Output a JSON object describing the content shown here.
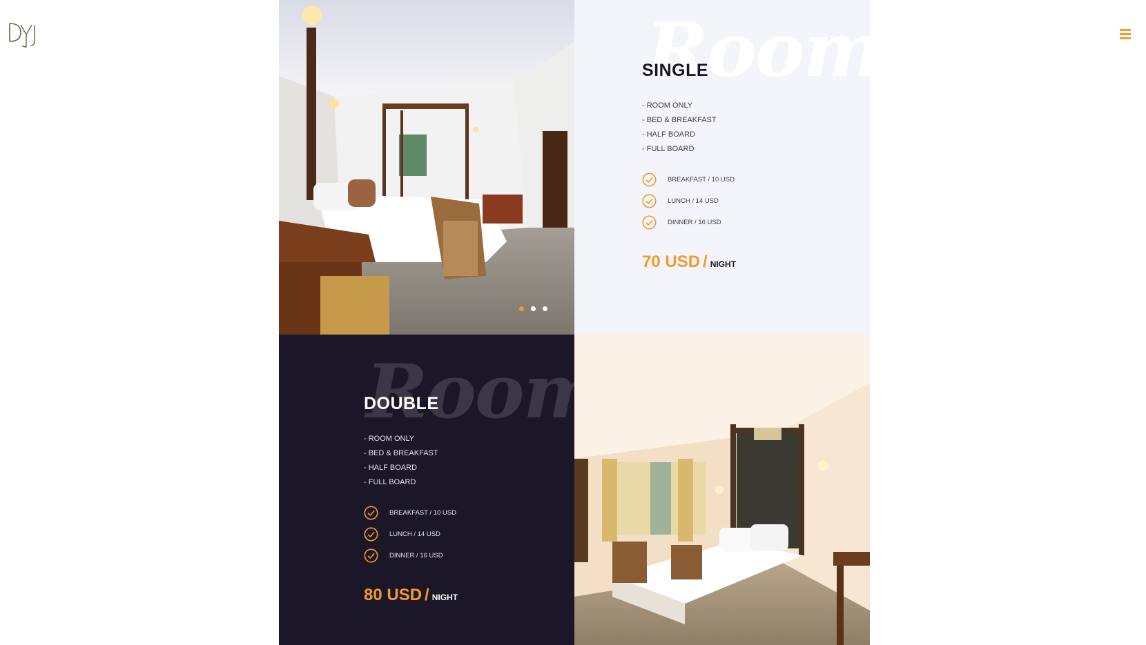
{
  "brand": {
    "logo_text": "DYJ"
  },
  "colors": {
    "accent": "#f29a2e",
    "dark_panel": "#1b1628",
    "light_panel": "#f4f5fb"
  },
  "rooms": [
    {
      "watermark": "Rooms",
      "title": "SINGLE",
      "options": [
        "- ROOM ONLY",
        "- BED & BREAKFAST",
        "- HALF BOARD",
        "- FULL BOARD"
      ],
      "meals": [
        "BREAKFAST / 10 USD",
        "LUNCH / 14 USD",
        "DINNER / 16 USD"
      ],
      "price": "70 USD",
      "price_sep": "/",
      "price_unit": "NIGHT"
    },
    {
      "watermark": "Rooms",
      "title": "DOUBLE",
      "options": [
        "- ROOM ONLY",
        "- BED & BREAKFAST",
        "- HALF BOARD",
        "- FULL BOARD"
      ],
      "meals": [
        "BREAKFAST / 10 USD",
        "LUNCH / 14 USD",
        "DINNER / 16 USD"
      ],
      "price": "80 USD",
      "price_sep": "/",
      "price_unit": "NIGHT"
    }
  ],
  "carousel": {
    "slides": 3,
    "active": 1
  },
  "icons": {
    "menu": "hamburger-menu-icon",
    "check": "check-circle-icon"
  }
}
